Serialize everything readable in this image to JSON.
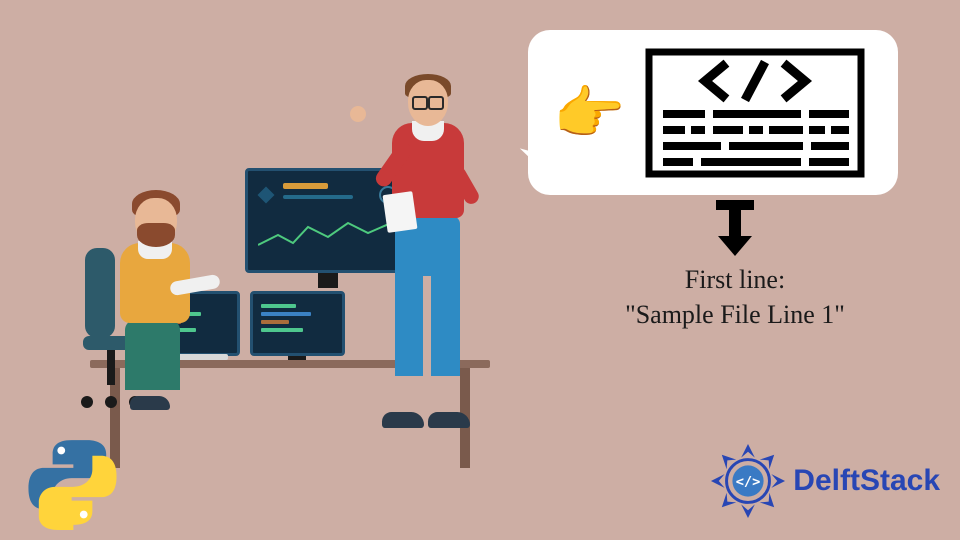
{
  "output": {
    "label": "First line:",
    "value": "\"Sample File Line 1\""
  },
  "brand": {
    "name": "DelftStack"
  },
  "icons": {
    "pointing": "👉"
  }
}
